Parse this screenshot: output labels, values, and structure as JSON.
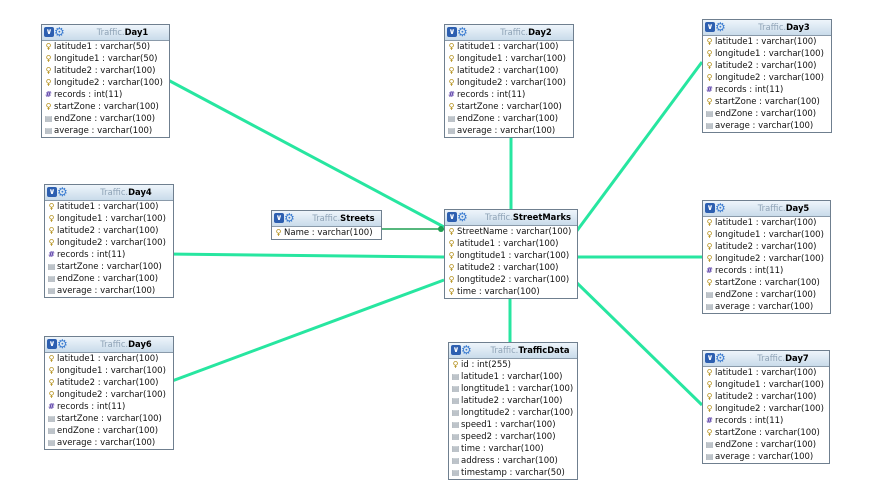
{
  "tables": [
    {
      "id": "day1",
      "schema": "Traffic.",
      "name": "Day1",
      "columns": [
        {
          "icon": "key-icon",
          "text": "latitude1 : varchar(50)"
        },
        {
          "icon": "key-icon",
          "text": "longitude1 : varchar(50)"
        },
        {
          "icon": "key-icon",
          "text": "latitude2 : varchar(100)"
        },
        {
          "icon": "key-icon",
          "text": "longitude2 : varchar(100)"
        },
        {
          "icon": "number-icon",
          "text": "records : int(11)"
        },
        {
          "icon": "key-icon",
          "text": "startZone : varchar(100)"
        },
        {
          "icon": "text-icon",
          "text": "endZone : varchar(100)"
        },
        {
          "icon": "text-icon",
          "text": "average : varchar(100)"
        }
      ]
    },
    {
      "id": "day2",
      "schema": "Traffic.",
      "name": "Day2",
      "columns": [
        {
          "icon": "key-icon",
          "text": "latitude1 : varchar(100)"
        },
        {
          "icon": "key-icon",
          "text": "longitude1 : varchar(100)"
        },
        {
          "icon": "key-icon",
          "text": "latitude2 : varchar(100)"
        },
        {
          "icon": "key-icon",
          "text": "longitude2 : varchar(100)"
        },
        {
          "icon": "number-icon",
          "text": "records : int(11)"
        },
        {
          "icon": "key-icon",
          "text": "startZone : varchar(100)"
        },
        {
          "icon": "text-icon",
          "text": "endZone : varchar(100)"
        },
        {
          "icon": "text-icon",
          "text": "average : varchar(100)"
        }
      ]
    },
    {
      "id": "day3",
      "schema": "Traffic.",
      "name": "Day3",
      "columns": [
        {
          "icon": "key-icon",
          "text": "latitude1 : varchar(100)"
        },
        {
          "icon": "key-icon",
          "text": "longitude1 : varchar(100)"
        },
        {
          "icon": "key-icon",
          "text": "latitude2 : varchar(100)"
        },
        {
          "icon": "key-icon",
          "text": "longitude2 : varchar(100)"
        },
        {
          "icon": "number-icon",
          "text": "records : int(11)"
        },
        {
          "icon": "key-icon",
          "text": "startZone : varchar(100)"
        },
        {
          "icon": "text-icon",
          "text": "endZone : varchar(100)"
        },
        {
          "icon": "text-icon",
          "text": "average : varchar(100)"
        }
      ]
    },
    {
      "id": "day4",
      "schema": "Traffic.",
      "name": "Day4",
      "columns": [
        {
          "icon": "key-icon",
          "text": "latitude1 : varchar(100)"
        },
        {
          "icon": "key-icon",
          "text": "longitude1 : varchar(100)"
        },
        {
          "icon": "key-icon",
          "text": "latitude2 : varchar(100)"
        },
        {
          "icon": "key-icon",
          "text": "longitude2 : varchar(100)"
        },
        {
          "icon": "number-icon",
          "text": "records : int(11)"
        },
        {
          "icon": "text-icon",
          "text": "startZone : varchar(100)"
        },
        {
          "icon": "text-icon",
          "text": "endZone : varchar(100)"
        },
        {
          "icon": "text-icon",
          "text": "average : varchar(100)"
        }
      ]
    },
    {
      "id": "streets",
      "schema": "Traffic.",
      "name": "Streets",
      "columns": [
        {
          "icon": "key-icon",
          "text": "Name : varchar(100)"
        }
      ]
    },
    {
      "id": "streetmarks",
      "schema": "Traffic.",
      "name": "StreetMarks",
      "columns": [
        {
          "icon": "key-icon",
          "text": "StreetName : varchar(100)"
        },
        {
          "icon": "key-icon",
          "text": "latitude1 : varchar(100)"
        },
        {
          "icon": "key-icon",
          "text": "longtitude1 : varchar(100)"
        },
        {
          "icon": "key-icon",
          "text": "latitude2 : varchar(100)"
        },
        {
          "icon": "key-icon",
          "text": "longtitude2 : varchar(100)"
        },
        {
          "icon": "key-icon",
          "text": "time : varchar(100)"
        }
      ]
    },
    {
      "id": "day5",
      "schema": "Traffic.",
      "name": "Day5",
      "columns": [
        {
          "icon": "key-icon",
          "text": "latitude1 : varchar(100)"
        },
        {
          "icon": "key-icon",
          "text": "longitude1 : varchar(100)"
        },
        {
          "icon": "key-icon",
          "text": "latitude2 : varchar(100)"
        },
        {
          "icon": "key-icon",
          "text": "longitude2 : varchar(100)"
        },
        {
          "icon": "number-icon",
          "text": "records : int(11)"
        },
        {
          "icon": "key-icon",
          "text": "startZone : varchar(100)"
        },
        {
          "icon": "text-icon",
          "text": "endZone : varchar(100)"
        },
        {
          "icon": "text-icon",
          "text": "average : varchar(100)"
        }
      ]
    },
    {
      "id": "day6",
      "schema": "Traffic.",
      "name": "Day6",
      "columns": [
        {
          "icon": "key-icon",
          "text": "latitude1 : varchar(100)"
        },
        {
          "icon": "key-icon",
          "text": "longitude1 : varchar(100)"
        },
        {
          "icon": "key-icon",
          "text": "latitude2 : varchar(100)"
        },
        {
          "icon": "key-icon",
          "text": "longitude2 : varchar(100)"
        },
        {
          "icon": "number-icon",
          "text": "records : int(11)"
        },
        {
          "icon": "text-icon",
          "text": "startZone : varchar(100)"
        },
        {
          "icon": "text-icon",
          "text": "endZone : varchar(100)"
        },
        {
          "icon": "text-icon",
          "text": "average : varchar(100)"
        }
      ]
    },
    {
      "id": "trafficdata",
      "schema": "Traffic.",
      "name": "TrafficData",
      "columns": [
        {
          "icon": "key-icon",
          "text": "id : int(255)"
        },
        {
          "icon": "text-icon",
          "text": "latitude1 : varchar(100)"
        },
        {
          "icon": "text-icon",
          "text": "longtitude1 : varchar(100)"
        },
        {
          "icon": "text-icon",
          "text": "latitude2 : varchar(100)"
        },
        {
          "icon": "text-icon",
          "text": "longtitude2 : varchar(100)"
        },
        {
          "icon": "text-icon",
          "text": "speed1 : varchar(100)"
        },
        {
          "icon": "text-icon",
          "text": "speed2 : varchar(100)"
        },
        {
          "icon": "text-icon",
          "text": "time : varchar(100)"
        },
        {
          "icon": "text-icon",
          "text": "address : varchar(100)"
        },
        {
          "icon": "text-icon",
          "text": "timestamp : varchar(50)"
        }
      ]
    },
    {
      "id": "day7",
      "schema": "Traffic.",
      "name": "Day7",
      "columns": [
        {
          "icon": "key-icon",
          "text": "latitude1 : varchar(100)"
        },
        {
          "icon": "key-icon",
          "text": "longitude1 : varchar(100)"
        },
        {
          "icon": "key-icon",
          "text": "latitude2 : varchar(100)"
        },
        {
          "icon": "key-icon",
          "text": "longitude2 : varchar(100)"
        },
        {
          "icon": "number-icon",
          "text": "records : int(11)"
        },
        {
          "icon": "key-icon",
          "text": "startZone : varchar(100)"
        },
        {
          "icon": "text-icon",
          "text": "endZone : varchar(100)"
        },
        {
          "icon": "text-icon",
          "text": "average : varchar(100)"
        }
      ]
    }
  ],
  "relationships": [
    {
      "from": "streetmarks",
      "to": "day1"
    },
    {
      "from": "streetmarks",
      "to": "day2"
    },
    {
      "from": "streetmarks",
      "to": "day3"
    },
    {
      "from": "streetmarks",
      "to": "day4"
    },
    {
      "from": "streetmarks",
      "to": "day5"
    },
    {
      "from": "streetmarks",
      "to": "day6"
    },
    {
      "from": "streetmarks",
      "to": "day7"
    },
    {
      "from": "streetmarks",
      "to": "trafficdata"
    },
    {
      "from": "streetmarks",
      "to": "streets"
    }
  ],
  "colors": {
    "link": "#27e6a0",
    "link_dark": "#1f9f52",
    "header_icon": "#2d5fb0"
  },
  "header_icons": [
    "chevron-down-icon",
    "gear-icon"
  ]
}
